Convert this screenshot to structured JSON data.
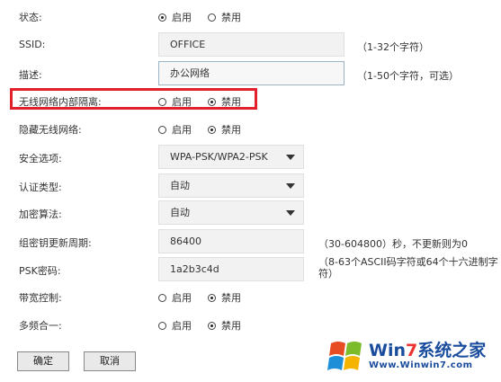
{
  "status": {
    "label": "状态:",
    "options": [
      "启用",
      "禁用"
    ],
    "selected": "启用"
  },
  "ssid": {
    "label": "SSID:",
    "value": "OFFICE",
    "hint": "（1-32个字符）"
  },
  "description": {
    "label": "描述:",
    "value": "办公网络",
    "hint": "（1-50个字符，可选）"
  },
  "isolation": {
    "label": "无线网络内部隔离:",
    "options": [
      "启用",
      "禁用"
    ],
    "selected": "禁用",
    "highlight_color": "#e2202b"
  },
  "hide_network": {
    "label": "隐藏无线网络:",
    "options": [
      "启用",
      "禁用"
    ],
    "selected": "禁用"
  },
  "security": {
    "label": "安全选项:",
    "value": "WPA-PSK/WPA2-PSK"
  },
  "auth_type": {
    "label": "认证类型:",
    "value": "自动"
  },
  "encryption": {
    "label": "加密算法:",
    "value": "自动"
  },
  "group_key_period": {
    "label": "组密钥更新周期:",
    "value": "86400",
    "hint": "（30-604800）秒，不更新则为0"
  },
  "psk": {
    "label": "PSK密码:",
    "value": "1a2b3c4d",
    "hint": "（8-63个ASCII码字符或64个十六进制字符）"
  },
  "bandwidth": {
    "label": "带宽控制:",
    "options": [
      "启用",
      "禁用"
    ],
    "selected": "禁用"
  },
  "band_merge": {
    "label": "多频合一:",
    "options": [
      "启用",
      "禁用"
    ],
    "selected": "禁用"
  },
  "buttons": {
    "confirm": "确定",
    "cancel": "取消"
  },
  "watermark": {
    "brand_a": "Win",
    "brand_7": "7",
    "brand_b": "系统之家",
    "url": "Www.Winwin7.com"
  }
}
